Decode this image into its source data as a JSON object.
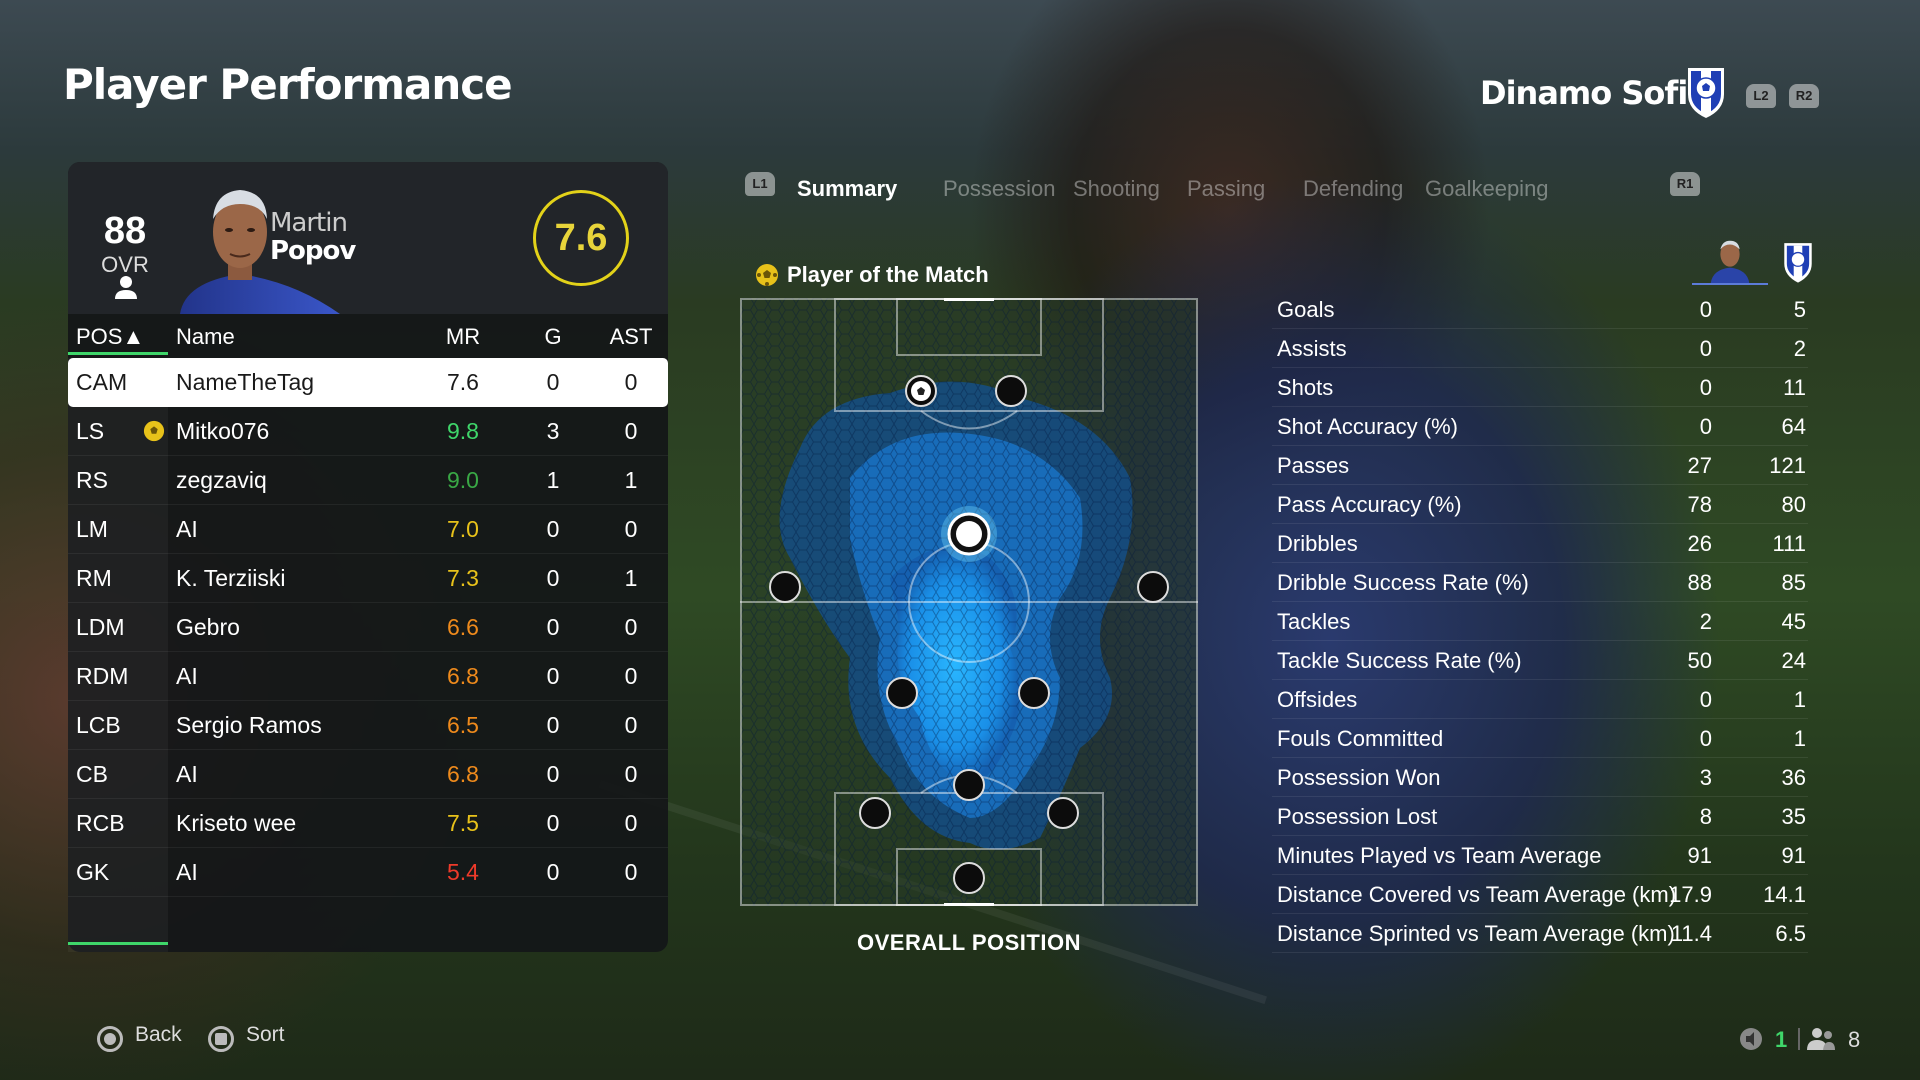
{
  "header": {
    "title": "Player Performance",
    "team_name": "Dinamo Sofia",
    "l2": "L2",
    "r2": "R2"
  },
  "player_card": {
    "ovr_value": "88",
    "ovr_label": "OVR",
    "first_name": "Martin",
    "last_name": "Popov",
    "match_rating": "7.6"
  },
  "table": {
    "headers": {
      "pos": "POS▲",
      "name": "Name",
      "mr": "MR",
      "g": "G",
      "ast": "AST"
    },
    "rows": [
      {
        "pos": "CAM",
        "name": "NameTheTag",
        "mr": "7.6",
        "g": "0",
        "ast": "0",
        "mr_color": "#1a1a1a"
      },
      {
        "pos": "LS",
        "name": "Mitko076",
        "mr": "9.8",
        "g": "3",
        "ast": "0",
        "mr_color": "#3fd66a"
      },
      {
        "pos": "RS",
        "name": "zegzaviq",
        "mr": "9.0",
        "g": "1",
        "ast": "1",
        "mr_color": "#39a845"
      },
      {
        "pos": "LM",
        "name": "AI",
        "mr": "7.0",
        "g": "0",
        "ast": "0",
        "mr_color": "#e8c21a"
      },
      {
        "pos": "RM",
        "name": "K. Terziiski",
        "mr": "7.3",
        "g": "0",
        "ast": "1",
        "mr_color": "#e8c21a"
      },
      {
        "pos": "LDM",
        "name": "Gebro",
        "mr": "6.6",
        "g": "0",
        "ast": "0",
        "mr_color": "#ee8a1c"
      },
      {
        "pos": "RDM",
        "name": "AI",
        "mr": "6.8",
        "g": "0",
        "ast": "0",
        "mr_color": "#ee8a1c"
      },
      {
        "pos": "LCB",
        "name": "Sergio Ramos",
        "mr": "6.5",
        "g": "0",
        "ast": "0",
        "mr_color": "#ee8a1c"
      },
      {
        "pos": "CB",
        "name": "AI",
        "mr": "6.8",
        "g": "0",
        "ast": "0",
        "mr_color": "#ee8a1c"
      },
      {
        "pos": "RCB",
        "name": "Kriseto wee",
        "mr": "7.5",
        "g": "0",
        "ast": "0",
        "mr_color": "#e8c21a"
      },
      {
        "pos": "GK",
        "name": "AI",
        "mr": "5.4",
        "g": "0",
        "ast": "0",
        "mr_color": "#ee3a2a"
      }
    ]
  },
  "tabs": {
    "l1": "L1",
    "r1": "R1",
    "items": [
      "Summary",
      "Possession",
      "Shooting",
      "Passing",
      "Defending",
      "Goalkeeping"
    ],
    "active": "Summary"
  },
  "pitch": {
    "potm_label": "Player of the Match",
    "caption": "OVERALL POSITION"
  },
  "stats": [
    {
      "label": "Goals",
      "player": "0",
      "team": "5"
    },
    {
      "label": "Assists",
      "player": "0",
      "team": "2"
    },
    {
      "label": "Shots",
      "player": "0",
      "team": "11"
    },
    {
      "label": "Shot Accuracy (%)",
      "player": "0",
      "team": "64"
    },
    {
      "label": "Passes",
      "player": "27",
      "team": "121"
    },
    {
      "label": "Pass Accuracy (%)",
      "player": "78",
      "team": "80"
    },
    {
      "label": "Dribbles",
      "player": "26",
      "team": "111"
    },
    {
      "label": "Dribble Success Rate (%)",
      "player": "88",
      "team": "85"
    },
    {
      "label": "Tackles",
      "player": "2",
      "team": "45"
    },
    {
      "label": "Tackle Success Rate (%)",
      "player": "50",
      "team": "24"
    },
    {
      "label": "Offsides",
      "player": "0",
      "team": "1"
    },
    {
      "label": "Fouls Committed",
      "player": "0",
      "team": "1"
    },
    {
      "label": "Possession Won",
      "player": "3",
      "team": "36"
    },
    {
      "label": "Possession Lost",
      "player": "8",
      "team": "35"
    },
    {
      "label": "Minutes Played vs Team Average",
      "player": "91",
      "team": "91"
    },
    {
      "label": "Distance Covered vs Team Average (km)",
      "player": "17.9",
      "team": "14.1"
    },
    {
      "label": "Distance Sprinted vs Team Average (km)",
      "player": "11.4",
      "team": "6.5"
    }
  ],
  "footer": {
    "back_label": "Back",
    "sort_label": "Sort",
    "mic_count": "1",
    "players_count": "8"
  },
  "colors": {
    "accent_green": "#3fd66a",
    "rating_yellow": "#e3d219",
    "heat_blue": "#1fa4ff"
  }
}
